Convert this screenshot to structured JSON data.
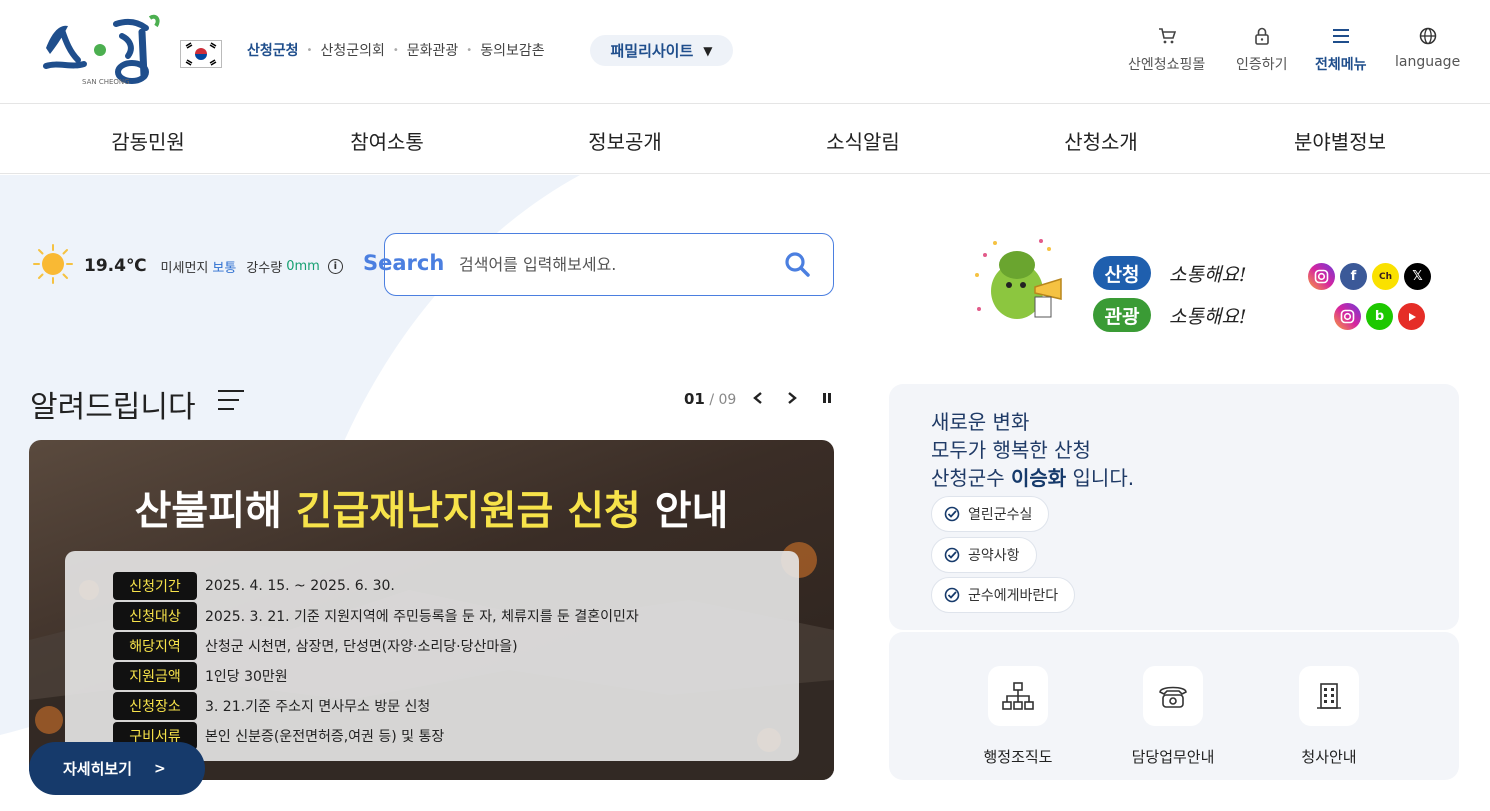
{
  "header": {
    "logo_text": "산엔청",
    "logo_sub": "SAN CHEONG",
    "sites": [
      "산청군청",
      "산청군의회",
      "문화관광",
      "동의보감촌"
    ],
    "family_label": "패밀리사이트",
    "utils": [
      {
        "label": "산엔청쇼핑몰",
        "icon": "cart-icon"
      },
      {
        "label": "인증하기",
        "icon": "lock-icon"
      },
      {
        "label": "전체메뉴",
        "icon": "menu-icon"
      },
      {
        "label": "language",
        "icon": "globe-icon"
      }
    ]
  },
  "nav": [
    "감동민원",
    "참여소통",
    "정보공개",
    "소식알림",
    "산청소개",
    "분야별정보"
  ],
  "weather": {
    "temp": "19.4℃",
    "dust_label": "미세먼지",
    "dust_value": "보통",
    "rain_label": "강수량",
    "rain_value": "0mm"
  },
  "search": {
    "label": "Search",
    "placeholder": "검색어를 입력해보세요."
  },
  "comm": [
    {
      "badge": "산청",
      "text": "소통해요!",
      "color": "#1f5fae"
    },
    {
      "badge": "관광",
      "text": "소통해요!",
      "color": "#3a9b35"
    }
  ],
  "notice": {
    "title": "알려드립니다",
    "current": "01",
    "total": "/ 09",
    "banner_title_a": "산불피해 ",
    "banner_title_b": "긴급재난지원금 신청",
    "banner_title_c": " 안내",
    "rows": [
      {
        "tag": "신청기간",
        "value": "2025. 4. 15. ~ 2025. 6. 30."
      },
      {
        "tag": "신청대상",
        "value": "2025. 3. 21. 기준 지원지역에 주민등록을 둔 자, 체류지를 둔 결혼이민자"
      },
      {
        "tag": "해당지역",
        "value": "산청군 시천면, 삼장면, 단성면(자양·소리당·당산마을)"
      },
      {
        "tag": "지원금액",
        "value": "1인당 30만원"
      },
      {
        "tag": "신청장소",
        "value": "3. 21.기준 주소지 면사무소 방문 신청"
      },
      {
        "tag": "구비서류",
        "value": "본인 신분증(운전면허증,여권 등) 및 통장"
      }
    ],
    "more_label": "자세히보기"
  },
  "mayor": {
    "line1": "새로운 변화",
    "line2": "모두가 행복한 산청",
    "line3_a": "산청군수 ",
    "line3_b": "이승화",
    "line3_c": " 입니다.",
    "links": [
      "열린군수실",
      "공약사항",
      "군수에게바란다"
    ]
  },
  "quick": [
    "행정조직도",
    "담당업무안내",
    "청사안내"
  ],
  "colors": {
    "brand": "#1f4e8c",
    "accent": "#4b7fe0",
    "dark_navy": "#163a6b",
    "highlight": "#f7e34a"
  }
}
